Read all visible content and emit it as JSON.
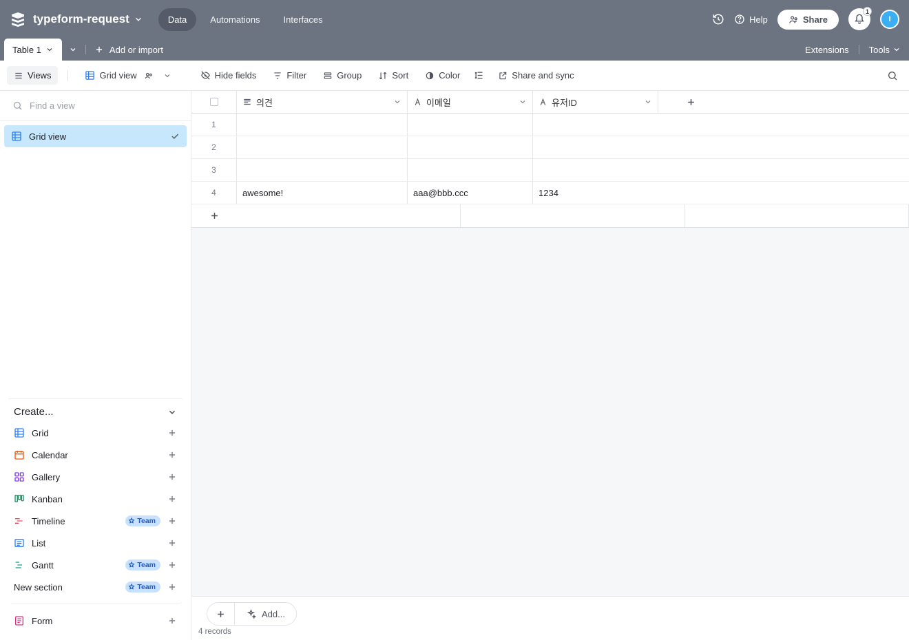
{
  "header": {
    "app_title": "typeform-request",
    "tabs": [
      "Data",
      "Automations",
      "Interfaces"
    ],
    "active_tab_index": 0,
    "help_label": "Help",
    "share_label": "Share",
    "notification_count": "1",
    "avatar_initial": "I"
  },
  "tabbar": {
    "table_tab": "Table 1",
    "add_or_import": "Add or import",
    "extensions": "Extensions",
    "tools": "Tools"
  },
  "toolbar": {
    "views": "Views",
    "grid_view": "Grid view",
    "hide_fields": "Hide fields",
    "filter": "Filter",
    "group": "Group",
    "sort": "Sort",
    "color": "Color",
    "share_sync": "Share and sync"
  },
  "sidebar": {
    "find_placeholder": "Find a view",
    "views": [
      {
        "label": "Grid view",
        "active": true
      }
    ],
    "create_label": "Create...",
    "create_items": [
      {
        "name": "Grid",
        "icon": "grid",
        "color": "#2d7ff9"
      },
      {
        "name": "Calendar",
        "icon": "calendar",
        "color": "#e9560b"
      },
      {
        "name": "Gallery",
        "icon": "gallery",
        "color": "#7c3aed"
      },
      {
        "name": "Kanban",
        "icon": "kanban",
        "color": "#0f9960"
      },
      {
        "name": "Timeline",
        "icon": "timeline",
        "color": "#e44a66",
        "team": true
      },
      {
        "name": "List",
        "icon": "list",
        "color": "#2d7ff9"
      },
      {
        "name": "Gantt",
        "icon": "gantt",
        "color": "#0f9d90",
        "team": true
      },
      {
        "name": "New section",
        "icon": "section",
        "color": "#4a4f5a",
        "team": true,
        "text_only": true
      }
    ],
    "team_label": "Team",
    "form_label": "Form"
  },
  "grid": {
    "columns": [
      {
        "label": "의견",
        "type": "long-text"
      },
      {
        "label": "이메일",
        "type": "text"
      },
      {
        "label": "유저ID",
        "type": "text"
      }
    ],
    "rows": [
      {
        "n": "1",
        "c0": "",
        "c1": "",
        "c2": ""
      },
      {
        "n": "2",
        "c0": "",
        "c1": "",
        "c2": ""
      },
      {
        "n": "3",
        "c0": "",
        "c1": "",
        "c2": ""
      },
      {
        "n": "4",
        "c0": "awesome!",
        "c1": "aaa@bbb.ccc",
        "c2": "1234"
      }
    ],
    "add_label": "Add...",
    "record_count": "4 records"
  }
}
